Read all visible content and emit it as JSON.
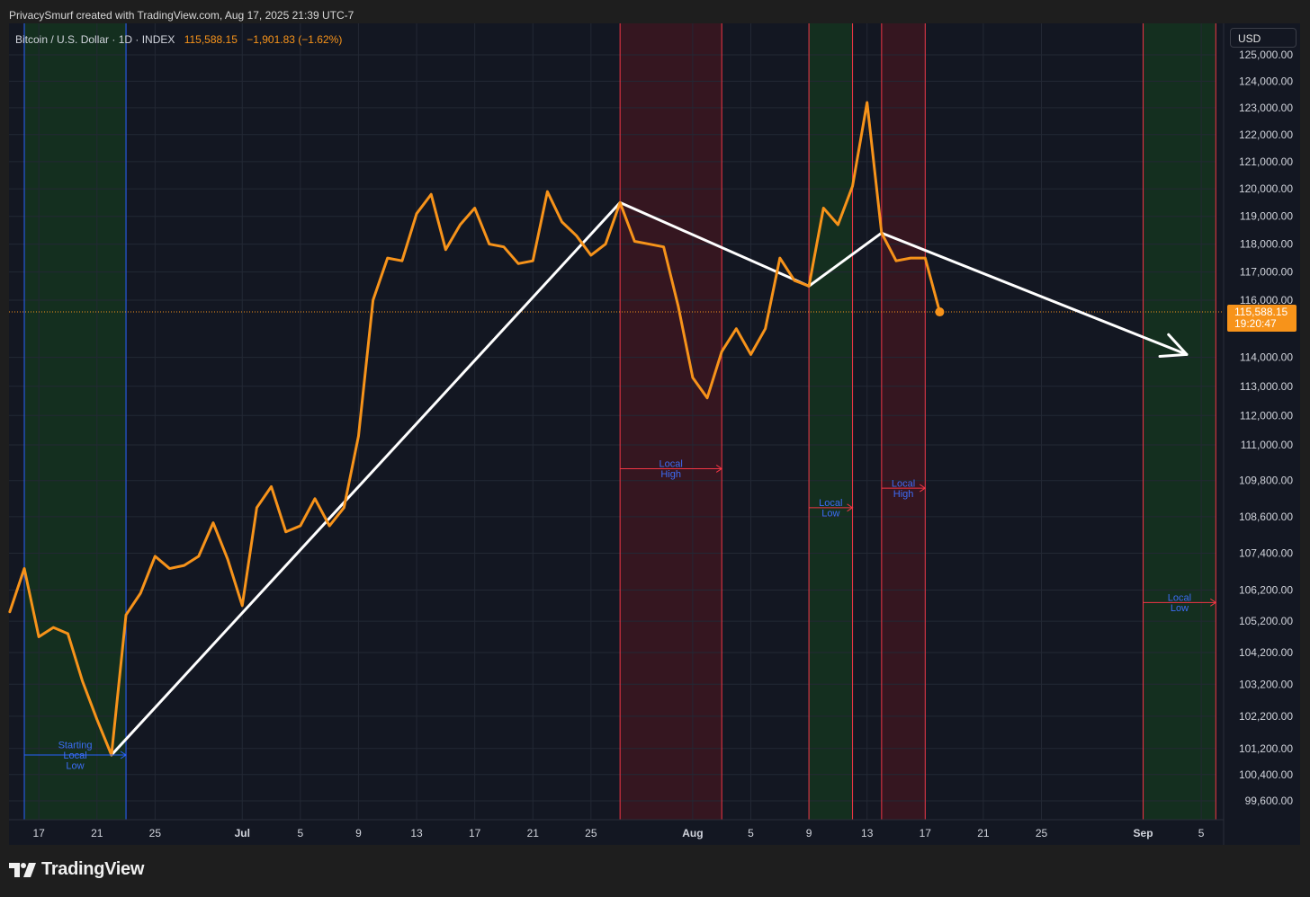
{
  "header": {
    "caption": "PrivacySmurf created with TradingView.com, Aug 17, 2025 21:39 UTC-7"
  },
  "legend": {
    "symbol": "Bitcoin / U.S. Dollar · 1D · INDEX",
    "price": "115,588.15",
    "change": "−1,901.83 (−1.62%)"
  },
  "currency": "USD",
  "last_price": {
    "value": 115588.15,
    "label": "115,588.15",
    "countdown": "19:20:47"
  },
  "brand": {
    "name": "TradingView"
  },
  "colors": {
    "background": "#131722",
    "price_line": "#f7931a",
    "trend_line": "#ffffff",
    "green_zone": "#15321f",
    "red_zone": "#3a1620",
    "red_line": "#f23645",
    "green_line": "#26a65b",
    "blue_line": "#2962ff",
    "annotation_text": "#3d6cf5",
    "axis_text": "#d1d4dc",
    "grid": "#232834"
  },
  "chart_data": {
    "type": "line",
    "x_ticks": [
      {
        "label": "17",
        "date": "2025-06-17"
      },
      {
        "label": "21",
        "date": "2025-06-21"
      },
      {
        "label": "25",
        "date": "2025-06-25"
      },
      {
        "label": "Jul",
        "date": "2025-07-01",
        "bold": true
      },
      {
        "label": "5",
        "date": "2025-07-05"
      },
      {
        "label": "9",
        "date": "2025-07-09"
      },
      {
        "label": "13",
        "date": "2025-07-13"
      },
      {
        "label": "17",
        "date": "2025-07-17"
      },
      {
        "label": "21",
        "date": "2025-07-21"
      },
      {
        "label": "25",
        "date": "2025-07-25"
      },
      {
        "label": "Aug",
        "date": "2025-08-01",
        "bold": true
      },
      {
        "label": "5",
        "date": "2025-08-05"
      },
      {
        "label": "9",
        "date": "2025-08-09"
      },
      {
        "label": "13",
        "date": "2025-08-13"
      },
      {
        "label": "17",
        "date": "2025-08-17"
      },
      {
        "label": "21",
        "date": "2025-08-21"
      },
      {
        "label": "25",
        "date": "2025-08-25"
      },
      {
        "label": "Sep",
        "date": "2025-09-01",
        "bold": true
      },
      {
        "label": "5",
        "date": "2025-09-05"
      }
    ],
    "y_ticks": [
      {
        "label": "125,000.00",
        "value": 125000
      },
      {
        "label": "124,000.00",
        "value": 124000
      },
      {
        "label": "123,000.00",
        "value": 123000
      },
      {
        "label": "122,000.00",
        "value": 122000
      },
      {
        "label": "121,000.00",
        "value": 121000
      },
      {
        "label": "120,000.00",
        "value": 120000
      },
      {
        "label": "119,000.00",
        "value": 119000
      },
      {
        "label": "118,000.00",
        "value": 118000
      },
      {
        "label": "117,000.00",
        "value": 117000
      },
      {
        "label": "116,000.00",
        "value": 116000
      },
      {
        "label": "114,000.00",
        "value": 114000
      },
      {
        "label": "113,000.00",
        "value": 113000
      },
      {
        "label": "112,000.00",
        "value": 112000
      },
      {
        "label": "111,000.00",
        "value": 111000
      },
      {
        "label": "109,800.00",
        "value": 109800
      },
      {
        "label": "108,600.00",
        "value": 108600
      },
      {
        "label": "107,400.00",
        "value": 107400
      },
      {
        "label": "106,200.00",
        "value": 106200
      },
      {
        "label": "105,200.00",
        "value": 105200
      },
      {
        "label": "104,200.00",
        "value": 104200
      },
      {
        "label": "103,200.00",
        "value": 103200
      },
      {
        "label": "102,200.00",
        "value": 102200
      },
      {
        "label": "101,200.00",
        "value": 101200
      },
      {
        "label": "100,400.00",
        "value": 100400
      },
      {
        "label": "99,600.00",
        "value": 99600
      }
    ],
    "y_scale": "log",
    "grid": true,
    "series": [
      {
        "type": "line",
        "points": [
          {
            "date": "2025-06-15",
            "value": 105500
          },
          {
            "date": "2025-06-16",
            "value": 106900
          },
          {
            "date": "2025-06-17",
            "value": 104700
          },
          {
            "date": "2025-06-18",
            "value": 105000
          },
          {
            "date": "2025-06-19",
            "value": 104800
          },
          {
            "date": "2025-06-20",
            "value": 103300
          },
          {
            "date": "2025-06-21",
            "value": 102100
          },
          {
            "date": "2025-06-22",
            "value": 101000
          },
          {
            "date": "2025-06-23",
            "value": 105400
          },
          {
            "date": "2025-06-24",
            "value": 106100
          },
          {
            "date": "2025-06-25",
            "value": 107300
          },
          {
            "date": "2025-06-26",
            "value": 106900
          },
          {
            "date": "2025-06-27",
            "value": 107000
          },
          {
            "date": "2025-06-28",
            "value": 107300
          },
          {
            "date": "2025-06-29",
            "value": 108400
          },
          {
            "date": "2025-06-30",
            "value": 107200
          },
          {
            "date": "2025-07-01",
            "value": 105700
          },
          {
            "date": "2025-07-02",
            "value": 108900
          },
          {
            "date": "2025-07-03",
            "value": 109600
          },
          {
            "date": "2025-07-04",
            "value": 108100
          },
          {
            "date": "2025-07-05",
            "value": 108300
          },
          {
            "date": "2025-07-06",
            "value": 109200
          },
          {
            "date": "2025-07-07",
            "value": 108300
          },
          {
            "date": "2025-07-08",
            "value": 108900
          },
          {
            "date": "2025-07-09",
            "value": 111300
          },
          {
            "date": "2025-07-10",
            "value": 116000
          },
          {
            "date": "2025-07-11",
            "value": 117500
          },
          {
            "date": "2025-07-12",
            "value": 117400
          },
          {
            "date": "2025-07-13",
            "value": 119100
          },
          {
            "date": "2025-07-14",
            "value": 119800
          },
          {
            "date": "2025-07-15",
            "value": 117800
          },
          {
            "date": "2025-07-16",
            "value": 118700
          },
          {
            "date": "2025-07-17",
            "value": 119300
          },
          {
            "date": "2025-07-18",
            "value": 118000
          },
          {
            "date": "2025-07-19",
            "value": 117900
          },
          {
            "date": "2025-07-20",
            "value": 117300
          },
          {
            "date": "2025-07-21",
            "value": 117400
          },
          {
            "date": "2025-07-22",
            "value": 119900
          },
          {
            "date": "2025-07-23",
            "value": 118800
          },
          {
            "date": "2025-07-24",
            "value": 118300
          },
          {
            "date": "2025-07-25",
            "value": 117600
          },
          {
            "date": "2025-07-26",
            "value": 118000
          },
          {
            "date": "2025-07-27",
            "value": 119500
          },
          {
            "date": "2025-07-28",
            "value": 118100
          },
          {
            "date": "2025-07-29",
            "value": 118000
          },
          {
            "date": "2025-07-30",
            "value": 117900
          },
          {
            "date": "2025-07-31",
            "value": 115800
          },
          {
            "date": "2025-08-01",
            "value": 113300
          },
          {
            "date": "2025-08-02",
            "value": 112600
          },
          {
            "date": "2025-08-03",
            "value": 114200
          },
          {
            "date": "2025-08-04",
            "value": 115000
          },
          {
            "date": "2025-08-05",
            "value": 114100
          },
          {
            "date": "2025-08-06",
            "value": 115000
          },
          {
            "date": "2025-08-07",
            "value": 117500
          },
          {
            "date": "2025-08-08",
            "value": 116700
          },
          {
            "date": "2025-08-09",
            "value": 116500
          },
          {
            "date": "2025-08-10",
            "value": 119300
          },
          {
            "date": "2025-08-11",
            "value": 118700
          },
          {
            "date": "2025-08-12",
            "value": 120100
          },
          {
            "date": "2025-08-13",
            "value": 123200
          },
          {
            "date": "2025-08-14",
            "value": 118400
          },
          {
            "date": "2025-08-15",
            "value": 117400
          },
          {
            "date": "2025-08-16",
            "value": 117500
          },
          {
            "date": "2025-08-17",
            "value": 117500
          },
          {
            "date": "2025-08-18",
            "value": 115588.15
          }
        ]
      }
    ],
    "trend_lines": [
      {
        "points": [
          {
            "date": "2025-06-22",
            "value": 101000
          },
          {
            "date": "2025-07-27",
            "value": 119500
          },
          {
            "date": "2025-08-09",
            "value": 116500
          },
          {
            "date": "2025-08-14",
            "value": 118400
          },
          {
            "date": "2025-09-04",
            "value": 114100
          }
        ],
        "arrow": true
      }
    ],
    "zones": [
      {
        "color": "green",
        "start": "2025-06-16",
        "end": "2025-06-23",
        "line": "blue"
      },
      {
        "color": "red",
        "start": "2025-07-27",
        "end": "2025-08-03",
        "line": "red"
      },
      {
        "color": "green",
        "start": "2025-08-09",
        "end": "2025-08-12",
        "line": "red"
      },
      {
        "color": "red",
        "start": "2025-08-14",
        "end": "2025-08-17",
        "line": "red"
      },
      {
        "color": "green",
        "start": "2025-09-01",
        "end": "2025-09-06",
        "line": "red"
      }
    ],
    "annotations": [
      {
        "lines": [
          "Starting",
          "Local",
          "Low"
        ],
        "start": "2025-06-16",
        "end": "2025-06-23",
        "y": 101000,
        "color": "blue"
      },
      {
        "lines": [
          "Local",
          "High"
        ],
        "start": "2025-07-27",
        "end": "2025-08-03",
        "y": 110200,
        "color": "red"
      },
      {
        "lines": [
          "Local",
          "Low"
        ],
        "start": "2025-08-09",
        "end": "2025-08-12",
        "y": 108900,
        "color": "red"
      },
      {
        "lines": [
          "Local",
          "High"
        ],
        "start": "2025-08-14",
        "end": "2025-08-17",
        "y": 109550,
        "color": "red"
      },
      {
        "lines": [
          "Local",
          "Low"
        ],
        "start": "2025-09-01",
        "end": "2025-09-06",
        "y": 105800,
        "color": "red"
      }
    ]
  }
}
